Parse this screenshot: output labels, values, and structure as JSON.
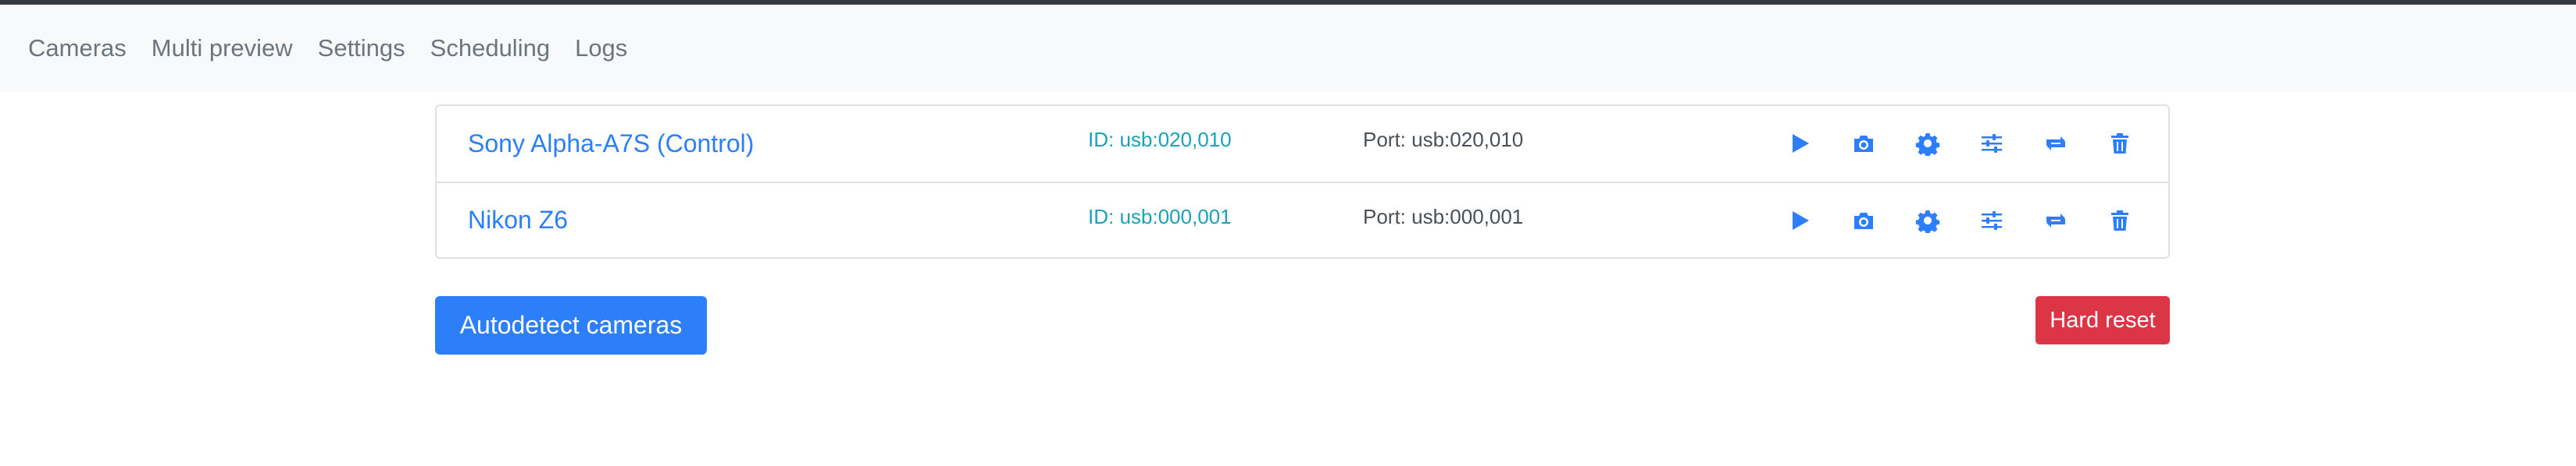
{
  "nav": {
    "items": [
      {
        "label": "Cameras"
      },
      {
        "label": "Multi preview"
      },
      {
        "label": "Settings"
      },
      {
        "label": "Scheduling"
      },
      {
        "label": "Logs"
      }
    ]
  },
  "cameras": [
    {
      "name": "Sony Alpha-A7S (Control)",
      "id": "ID: usb:020,010",
      "port": "Port: usb:020,010"
    },
    {
      "name": "Nikon Z6",
      "id": "ID: usb:000,001",
      "port": "Port: usb:000,001"
    }
  ],
  "actions": [
    {
      "icon": "play-icon"
    },
    {
      "icon": "camera-icon"
    },
    {
      "icon": "gear-icon"
    },
    {
      "icon": "sliders-icon"
    },
    {
      "icon": "swap-icon"
    },
    {
      "icon": "trash-icon"
    }
  ],
  "buttons": {
    "autodetect": "Autodetect cameras",
    "hard_reset": "Hard reset"
  },
  "colors": {
    "primary": "#2d7ff9",
    "info": "#17a2b8",
    "danger": "#dc3545",
    "navbar_bg": "#f8f9fa"
  }
}
